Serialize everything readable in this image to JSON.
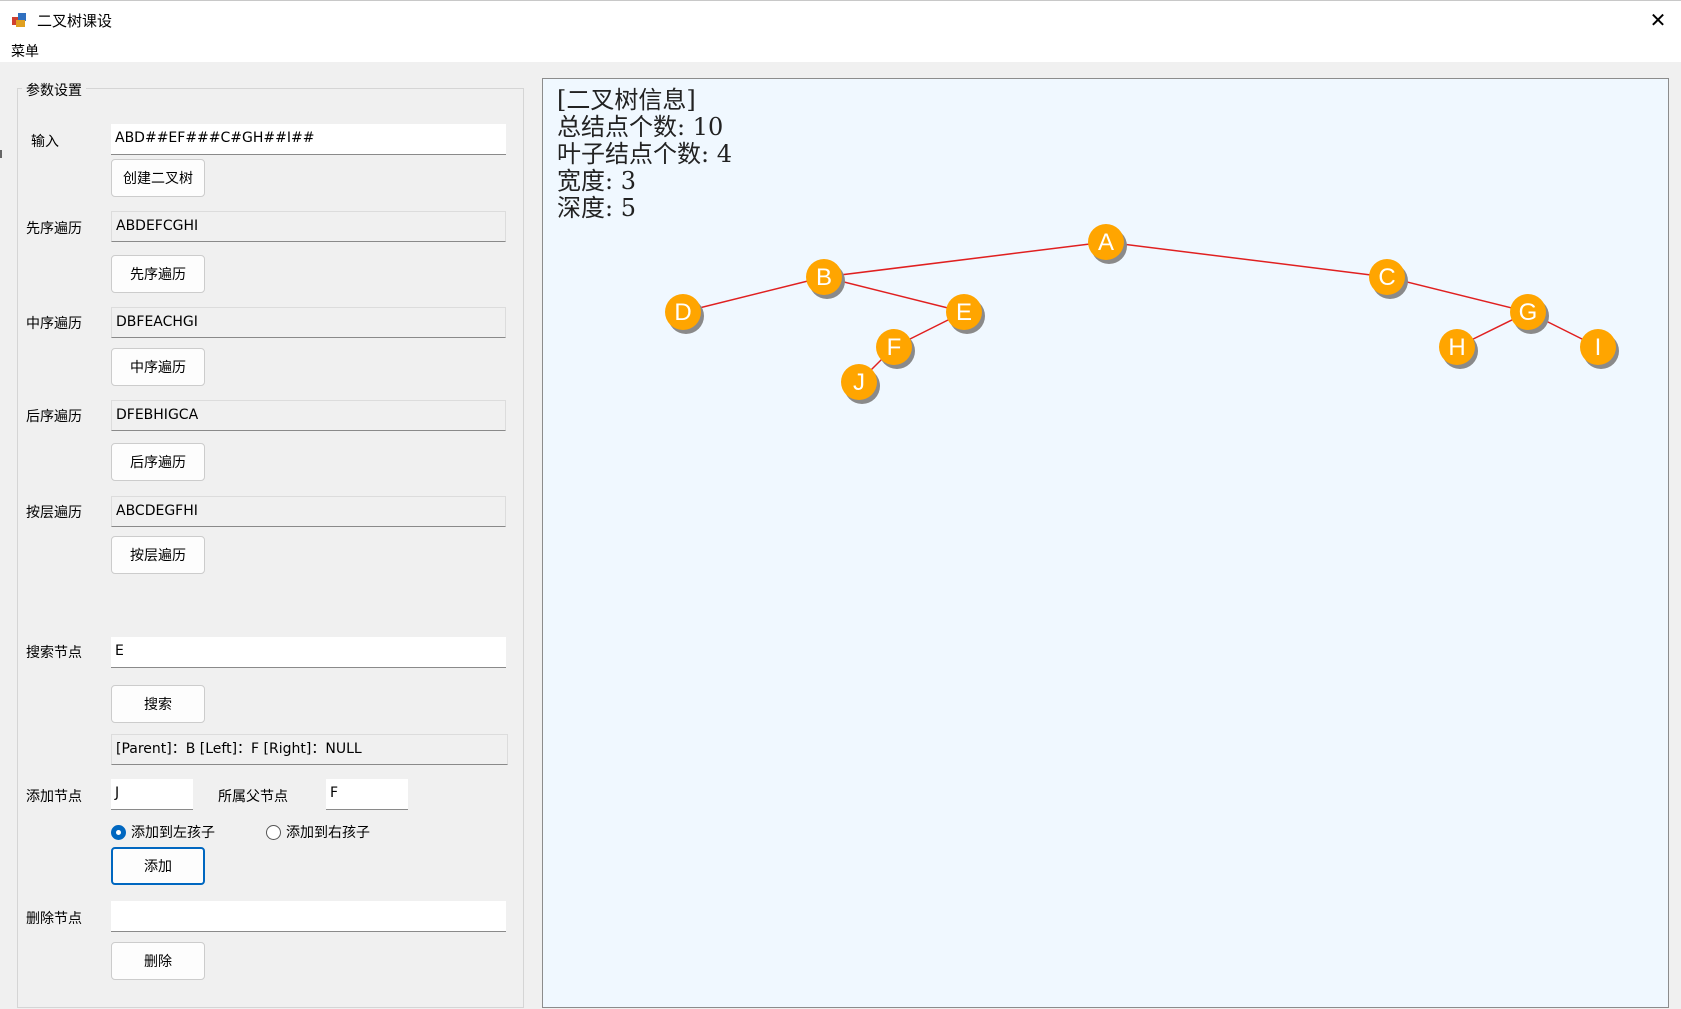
{
  "window": {
    "title": "二叉树课设",
    "close_glyph": "✕"
  },
  "menu": {
    "items": [
      "菜单"
    ]
  },
  "params": {
    "group_title": "参数设置",
    "input": {
      "label": "输入",
      "value": "ABD##EF###C#GH##I##",
      "button": "创建二叉树"
    },
    "preorder": {
      "label": "先序遍历",
      "value": "ABDEFCGHI",
      "button": "先序遍历"
    },
    "inorder": {
      "label": "中序遍历",
      "value": "DBFEACHGI",
      "button": "中序遍历"
    },
    "postorder": {
      "label": "后序遍历",
      "value": "DFEBHIGCA",
      "button": "后序遍历"
    },
    "levelorder": {
      "label": "按层遍历",
      "value": "ABCDEGFHI",
      "button": "按层遍历"
    },
    "search": {
      "label": "搜索节点",
      "value": "E",
      "button": "搜索",
      "result": "[Parent]：B [Left]：F [Right]：NULL"
    },
    "add": {
      "label": "添加节点",
      "value": "J",
      "parent_label": "所属父节点",
      "parent_value": "F",
      "radio_left": "添加到左孩子",
      "radio_right": "添加到右孩子",
      "selected": "left",
      "button": "添加"
    },
    "delete": {
      "label": "删除节点",
      "value": "",
      "button": "删除"
    }
  },
  "tree_info": {
    "heading": "[二叉树信息]",
    "total_nodes": "总结点个数: 10",
    "leaf_nodes": "叶子结点个数: 4",
    "width": "宽度: 3",
    "depth": "深度: 5"
  },
  "tree": {
    "node_color": "#ffa500",
    "edge_color": "#e02020",
    "nodes": [
      "A",
      "B",
      "C",
      "D",
      "E",
      "F",
      "J",
      "G",
      "H",
      "I"
    ],
    "edges": [
      [
        "A",
        "B"
      ],
      [
        "A",
        "C"
      ],
      [
        "B",
        "D"
      ],
      [
        "B",
        "E"
      ],
      [
        "E",
        "F"
      ],
      [
        "F",
        "J"
      ],
      [
        "C",
        "G"
      ],
      [
        "G",
        "H"
      ],
      [
        "G",
        "I"
      ]
    ]
  }
}
